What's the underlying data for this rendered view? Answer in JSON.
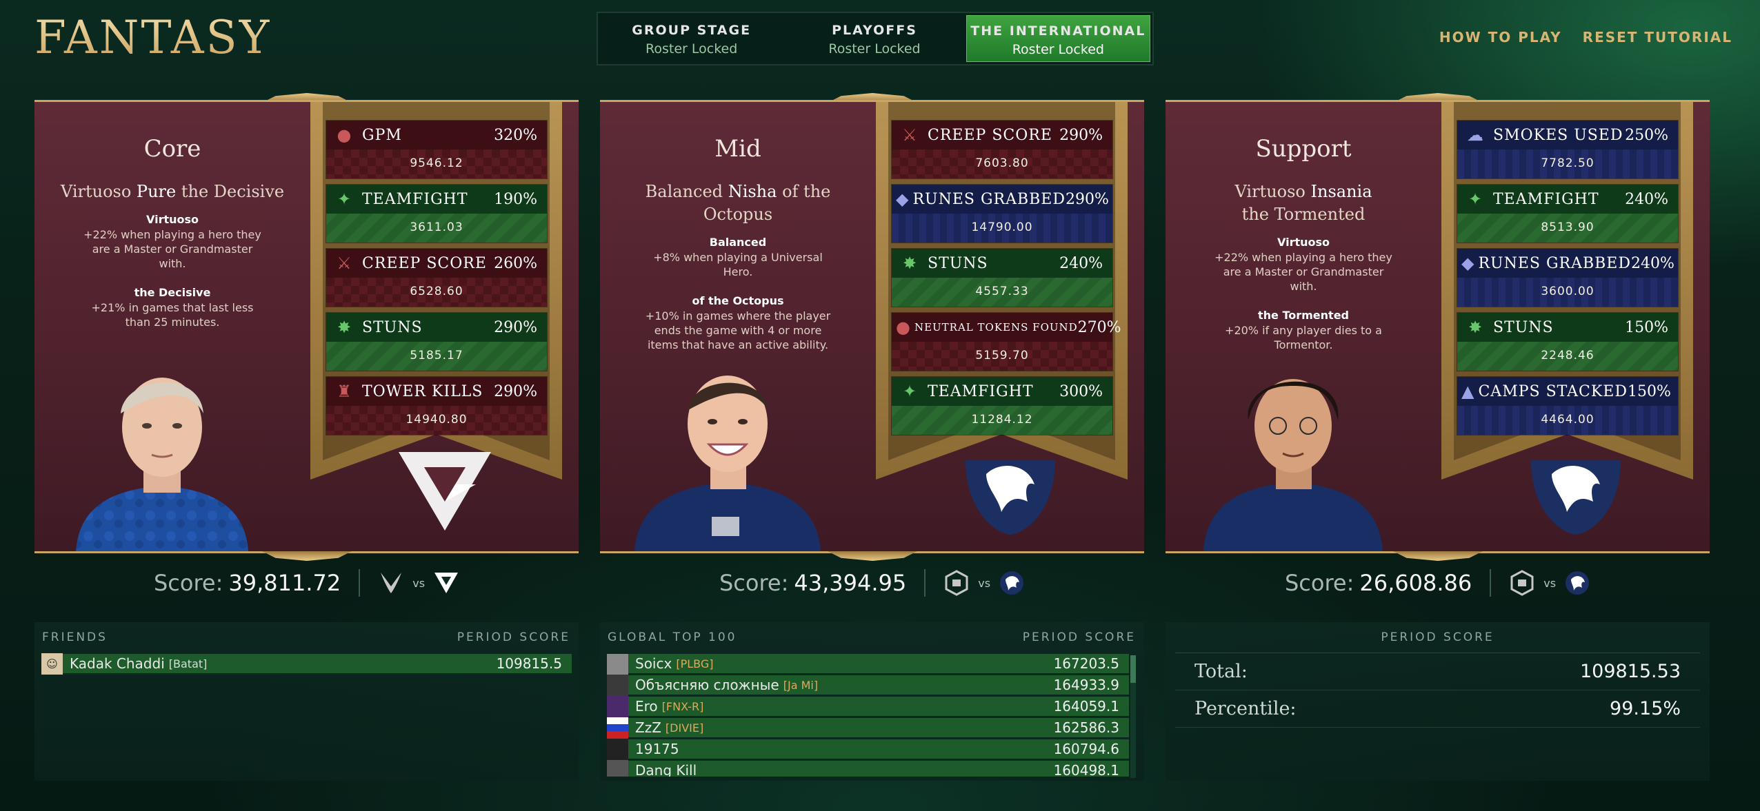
{
  "header": {
    "logo": "FANTASY",
    "stages": [
      {
        "name": "GROUP STAGE",
        "status": "Roster Locked"
      },
      {
        "name": "PLAYOFFS",
        "status": "Roster Locked"
      },
      {
        "name": "THE INTERNATIONAL",
        "status": "Roster Locked"
      }
    ],
    "links": {
      "how_to_play": "HOW TO PLAY",
      "reset_tutorial": "RESET TUTORIAL"
    }
  },
  "cards": [
    {
      "role": "Core",
      "name_prefix": "Virtuoso",
      "name_player": "Pure",
      "name_suffix": "the Decisive",
      "bonus1_title": "Virtuoso",
      "bonus1_desc": "+22% when playing a hero they are a Master or Grandmaster with.",
      "bonus2_title": "the Decisive",
      "bonus2_desc": "+21% in games that last less than 25 minutes.",
      "stats": [
        {
          "name": "GPM",
          "pct": "320%",
          "value": "9546.12",
          "color": "red",
          "icon": "gold-coin-icon"
        },
        {
          "name": "TEAMFIGHT",
          "pct": "190%",
          "value": "3611.03",
          "color": "green",
          "icon": "teamfight-icon"
        },
        {
          "name": "CREEP SCORE",
          "pct": "260%",
          "value": "6528.60",
          "color": "red",
          "icon": "creep-icon"
        },
        {
          "name": "STUNS",
          "pct": "290%",
          "value": "5185.17",
          "color": "green",
          "icon": "stun-icon"
        },
        {
          "name": "TOWER KILLS",
          "pct": "290%",
          "value": "14940.80",
          "color": "red",
          "icon": "tower-icon"
        }
      ],
      "team_logo": "tundra-logo",
      "score_label": "Score:",
      "score": "39,811.72",
      "vs": "vs",
      "opponent_logos": [
        "xtreme-logo",
        "tundra-logo"
      ]
    },
    {
      "role": "Mid",
      "name_prefix": "Balanced",
      "name_player": "Nisha",
      "name_suffix": "of the Octopus",
      "bonus1_title": "Balanced",
      "bonus1_desc": "+8% when playing a Universal Hero.",
      "bonus2_title": "of the Octopus",
      "bonus2_desc": "+10% in games where the player ends the game with 4 or more items that have an active ability.",
      "stats": [
        {
          "name": "CREEP SCORE",
          "pct": "290%",
          "value": "7603.80",
          "color": "red",
          "icon": "creep-icon"
        },
        {
          "name": "RUNES GRABBED",
          "pct": "290%",
          "value": "14790.00",
          "color": "blue",
          "icon": "rune-icon"
        },
        {
          "name": "STUNS",
          "pct": "240%",
          "value": "4557.33",
          "color": "green",
          "icon": "stun-icon"
        },
        {
          "name": "NEUTRAL TOKENS FOUND",
          "pct": "270%",
          "value": "5159.70",
          "color": "red",
          "icon": "token-icon"
        },
        {
          "name": "TEAMFIGHT",
          "pct": "300%",
          "value": "11284.12",
          "color": "green",
          "icon": "teamfight-icon"
        }
      ],
      "team_logo": "liquid-logo",
      "score_label": "Score:",
      "score": "43,394.95",
      "vs": "vs",
      "opponent_logos": [
        "gaimin-logo",
        "liquid-logo"
      ]
    },
    {
      "role": "Support",
      "name_prefix": "Virtuoso",
      "name_player": "Insania",
      "name_suffix": "the Tormented",
      "bonus1_title": "Virtuoso",
      "bonus1_desc": "+22% when playing a hero they are a Master or Grandmaster with.",
      "bonus2_title": "the Tormented",
      "bonus2_desc": "+20% if any player dies to a Tormentor.",
      "stats": [
        {
          "name": "SMOKES USED",
          "pct": "250%",
          "value": "7782.50",
          "color": "blue",
          "icon": "smoke-icon"
        },
        {
          "name": "TEAMFIGHT",
          "pct": "240%",
          "value": "8513.90",
          "color": "green",
          "icon": "teamfight-icon"
        },
        {
          "name": "RUNES GRABBED",
          "pct": "240%",
          "value": "3600.00",
          "color": "blue",
          "icon": "rune-icon"
        },
        {
          "name": "STUNS",
          "pct": "150%",
          "value": "2248.46",
          "color": "green",
          "icon": "stun-icon"
        },
        {
          "name": "CAMPS STACKED",
          "pct": "150%",
          "value": "4464.00",
          "color": "blue",
          "icon": "camp-icon"
        }
      ],
      "team_logo": "liquid-logo",
      "score_label": "Score:",
      "score": "26,608.86",
      "vs": "vs",
      "opponent_logos": [
        "gaimin-logo",
        "liquid-logo"
      ]
    }
  ],
  "friends": {
    "title": "FRIENDS",
    "col": "PERIOD SCORE",
    "rows": [
      {
        "name": "Kadak Chaddi",
        "tag": "[Batat]",
        "score": "109815.5"
      }
    ]
  },
  "global": {
    "title": "GLOBAL TOP 100",
    "col": "PERIOD SCORE",
    "rows": [
      {
        "name": "Soicx",
        "tag": "[PLBG]",
        "score": "167203.5"
      },
      {
        "name": "Объясняю сложные",
        "tag": "[Ja Mi]",
        "score": "164933.9"
      },
      {
        "name": "Ero",
        "tag": "[FNX-R]",
        "score": "164059.1"
      },
      {
        "name": "ZzZ",
        "tag": "[DIVIE]",
        "score": "162586.3"
      },
      {
        "name": "19175",
        "tag": "",
        "score": "160794.6"
      },
      {
        "name": "Dang Kill",
        "tag": "",
        "score": "160498.1"
      }
    ]
  },
  "period": {
    "title": "PERIOD SCORE",
    "total_label": "Total:",
    "total": "109815.53",
    "percentile_label": "Percentile:",
    "percentile": "99.15%"
  },
  "colors": {
    "gold": "#c9a763",
    "card_bg": "#5e2b37",
    "active_stage": "#2e8f36"
  }
}
